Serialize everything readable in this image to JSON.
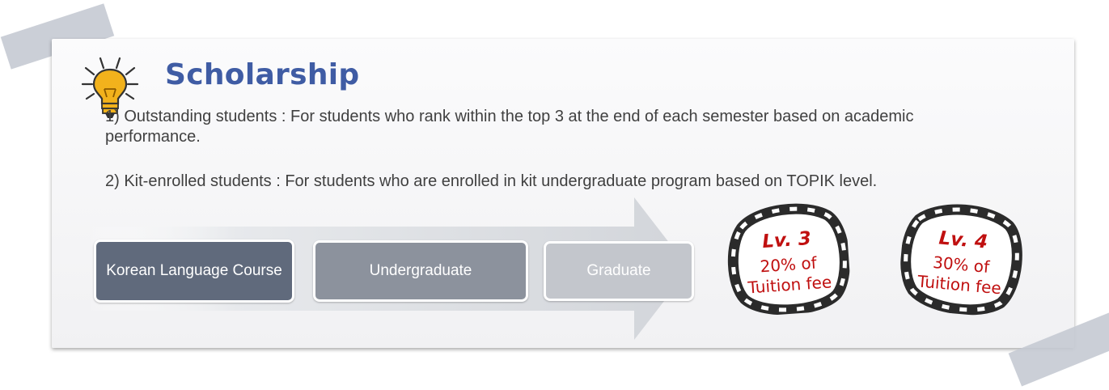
{
  "title": "Scholarship",
  "paragraphs": [
    "1) Outstanding students : For students who rank within the top 3 at the end of each semester based on academic performance.",
    "2) Kit-enrolled students : For students who are enrolled in kit undergraduate  program based on TOPIK  level."
  ],
  "stages": [
    "Korean Language Course",
    "Undergraduate",
    "Graduate"
  ],
  "badges": [
    {
      "level": "Lv. 3",
      "line2": "20% of",
      "line3": "Tuition fee"
    },
    {
      "level": "Lv. 4",
      "line2": "30% of",
      "line3": "Tuition fee"
    }
  ],
  "colors": {
    "title": "#3f5ca4",
    "badge_text": "#c01010",
    "stage_dark": "#606a7c",
    "stage_mid": "#8c929d",
    "stage_light": "#c3c6cc",
    "tape": "#c5cad3"
  },
  "icons": {
    "title_icon": "lightbulb-icon"
  }
}
